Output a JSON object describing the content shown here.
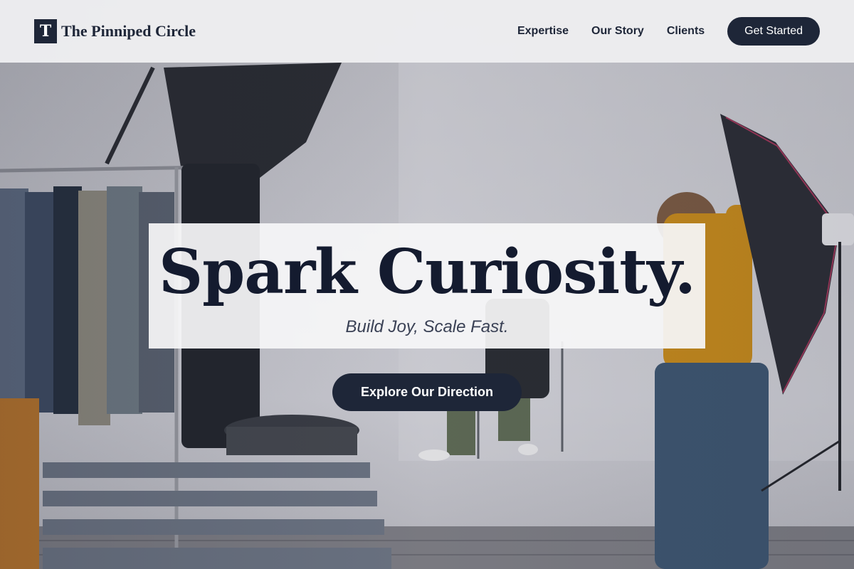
{
  "brand": {
    "logo_letter": "T",
    "name": "The Pinniped Circle"
  },
  "nav": {
    "links": [
      {
        "label": "Expertise"
      },
      {
        "label": "Our Story"
      },
      {
        "label": "Clients"
      }
    ],
    "cta_label": "Get Started"
  },
  "hero": {
    "title": "Spark Curiosity.",
    "subtitle": "Build Joy, Scale Fast.",
    "cta_label": "Explore Our Direction",
    "background_image": "photo-studio-scene"
  },
  "colors": {
    "brand_navy": "#1e2638",
    "title_navy": "#141b2f",
    "header_bg": "#eeeef0",
    "card_bg": "#f6f6f8"
  }
}
